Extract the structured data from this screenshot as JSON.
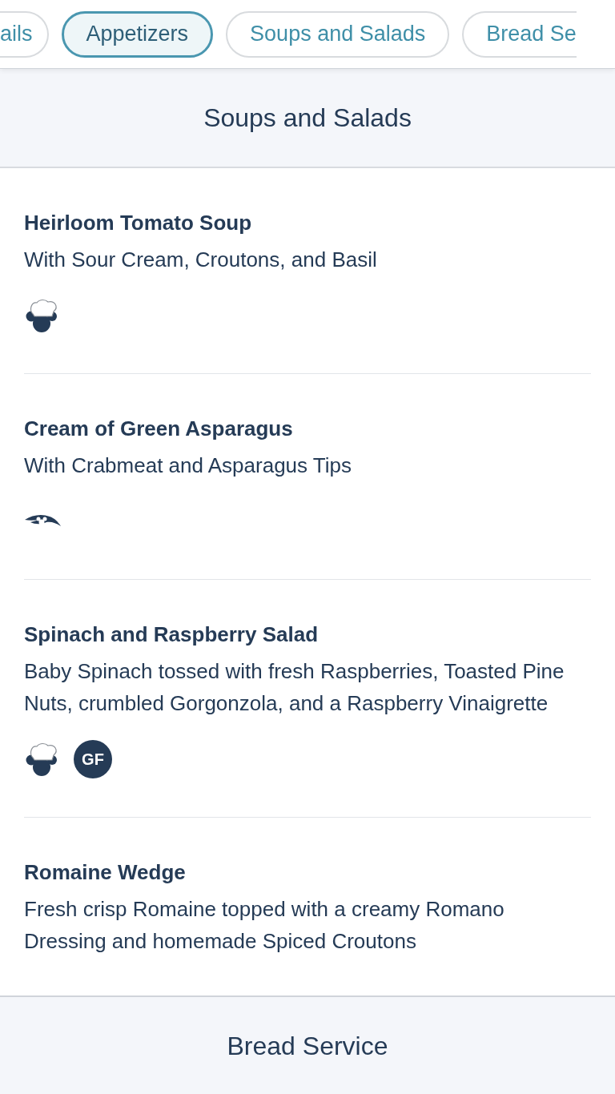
{
  "tabs": [
    {
      "label": "ails",
      "selected": false
    },
    {
      "label": "Appetizers",
      "selected": true
    },
    {
      "label": "Soups and Salads",
      "selected": false
    },
    {
      "label": "Bread Se",
      "selected": false
    }
  ],
  "sections": [
    {
      "title": "Soups and Salads",
      "items": [
        {
          "name": "Heirloom Tomato Soup",
          "description": "With Sour Cream, Croutons, and Basil",
          "icons": [
            {
              "kind": "chef"
            }
          ]
        },
        {
          "name": "Cream of Green Asparagus",
          "description": "With Crabmeat and Asparagus Tips",
          "icons": [
            {
              "kind": "ship"
            }
          ]
        },
        {
          "name": "Spinach and Raspberry Salad",
          "description": "Baby Spinach tossed with fresh Raspberries, Toasted Pine Nuts, crumbled Gorgonzola, and a Raspberry Vinaigrette",
          "icons": [
            {
              "kind": "chef"
            },
            {
              "kind": "badge",
              "label": "GF"
            }
          ]
        },
        {
          "name": "Romaine Wedge",
          "description": "Fresh crisp Romaine topped with a creamy Romano Dressing and homemade Spiced Croutons"
        }
      ]
    },
    {
      "title": "Bread Service"
    }
  ]
}
